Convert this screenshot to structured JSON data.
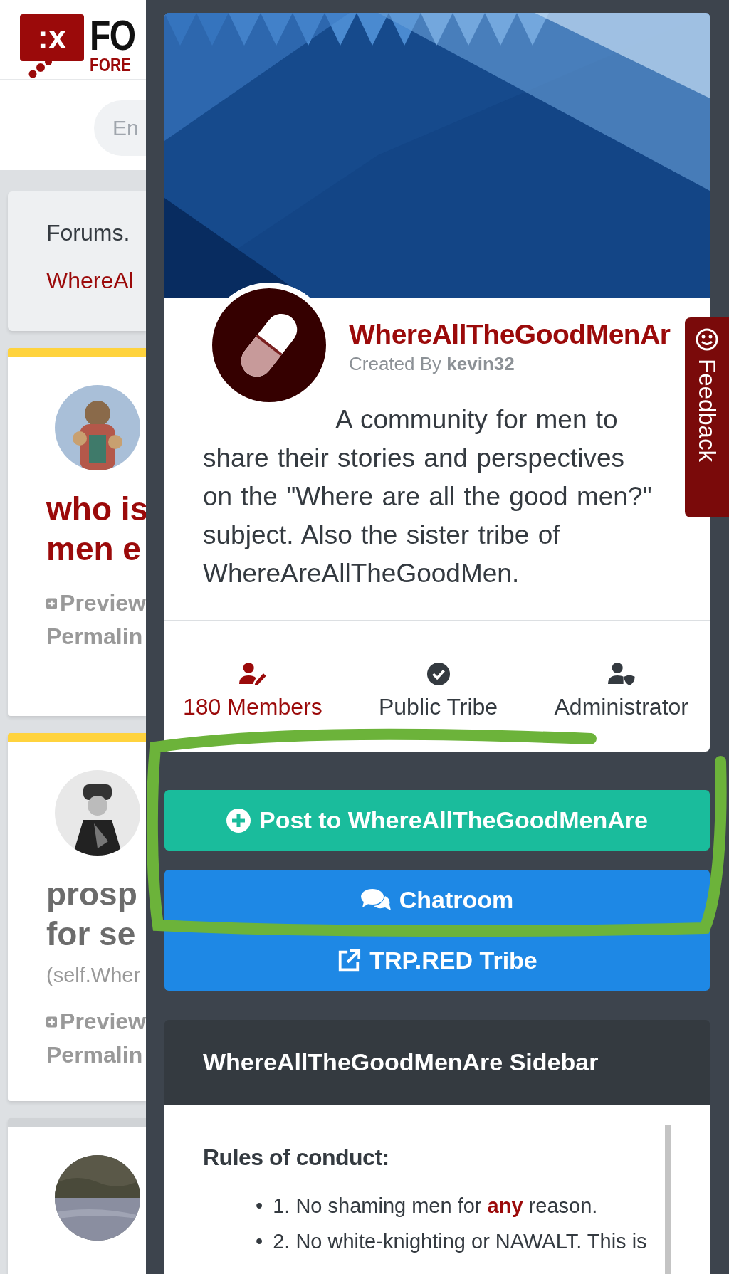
{
  "site": {
    "logo_mark": ":x",
    "logo_title": "FO",
    "logo_subtitle": "FORE",
    "search": {
      "placeholder": "En"
    },
    "breadcrumb": {
      "path": "Forums.",
      "current": "WhereAl"
    },
    "posts": [
      {
        "title_lines": [
          "who is",
          "men e"
        ],
        "visited": false,
        "preview": "Preview",
        "permalink": "Permalin"
      },
      {
        "title_lines": [
          "prosp",
          "for se"
        ],
        "visited": true,
        "byline": "(self.Wher",
        "preview": "Preview",
        "permalink": "Permalin"
      },
      {
        "kind": "picture"
      }
    ]
  },
  "tribe": {
    "name": "WhereAllTheGoodMenAr",
    "created_by_label": "Created By",
    "creator": "kevin32",
    "description": "A community for men to share their stories and perspectives on the \"Where are all the good men?\" subject. Also the sister tribe of WhereAreAllTheGoodMen.",
    "stats": [
      {
        "kind": "members",
        "label": "180 Members",
        "active": true
      },
      {
        "kind": "public",
        "label": "Public Tribe",
        "active": false
      },
      {
        "kind": "admin",
        "label": "Administrator",
        "active": false
      }
    ],
    "buttons": [
      {
        "kind": "post",
        "label": "Post to WhereAllTheGoodMenAre"
      },
      {
        "kind": "chat",
        "label": "Chatroom"
      },
      {
        "kind": "external",
        "label": "TRP.RED Tribe"
      }
    ]
  },
  "sidebar": {
    "title": "WhereAllTheGoodMenAre Sidebar",
    "rules_heading": "Rules of conduct:",
    "rules": [
      {
        "marker": "•",
        "text": "1. No shaming men for **any** reason."
      },
      {
        "marker": "•",
        "text": "2. No white-knighting or NAWALT. This is"
      }
    ]
  },
  "feedback": {
    "label": "Feedback"
  }
}
